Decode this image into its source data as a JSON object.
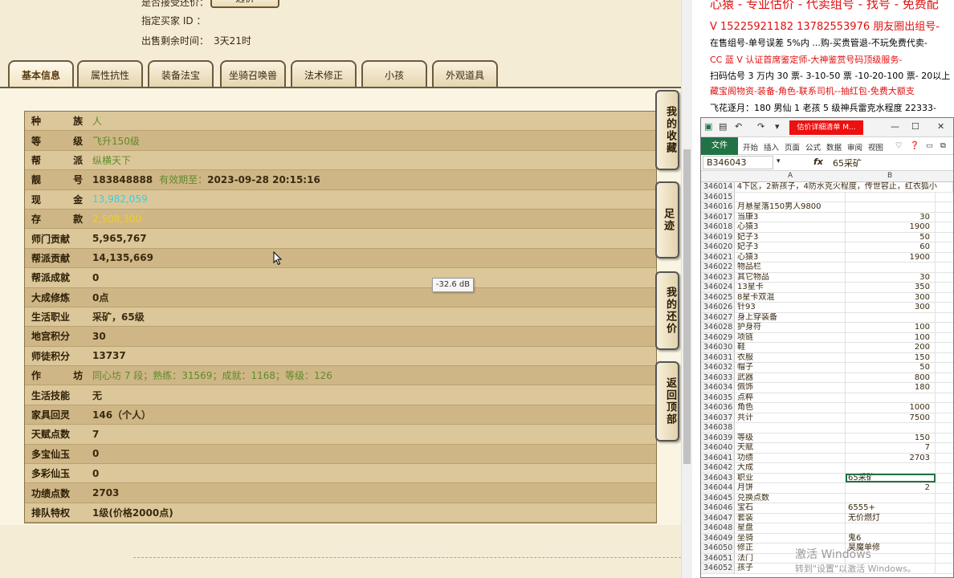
{
  "top": {
    "line0": "是否接受还价：",
    "choose_button": "选价",
    "buyer_label": "指定买家 ID ：",
    "time_label": "出售剩余时间：",
    "time_value": "3天21时"
  },
  "tabs": [
    "基本信息",
    "属性抗性",
    "装备法宝",
    "坐骑召唤兽",
    "法术修正",
    "小孩",
    "外观道具"
  ],
  "rows": [
    {
      "k": "种 族",
      "v": "人",
      "style": "green",
      "spaced": true
    },
    {
      "k": "等 级",
      "v": "飞升150级",
      "style": "green",
      "spaced": true
    },
    {
      "k": "帮 派",
      "v": "纵横天下",
      "style": "green",
      "spaced": true
    },
    {
      "k": "靓 号",
      "v": "183848888",
      "style": "bold",
      "spaced": true,
      "sub_label": "有效期至：",
      "sub_value": "2023-09-28 20:15:16"
    },
    {
      "k": "现 金",
      "v": "13,982,059",
      "style": "cyan",
      "spaced": true
    },
    {
      "k": "存 款",
      "v": "2,508,300",
      "style": "gold",
      "spaced": true
    },
    {
      "k": "师门贡献",
      "v": "5,965,767",
      "style": "bold"
    },
    {
      "k": "帮派贡献",
      "v": "14,135,669",
      "style": "bold"
    },
    {
      "k": "帮派成就",
      "v": "0",
      "style": "bold"
    },
    {
      "k": "大成修炼",
      "v": "0点",
      "style": "bold"
    },
    {
      "k": "生活职业",
      "v": "采矿，65级",
      "style": "bold"
    },
    {
      "k": "地宫积分",
      "v": "30",
      "style": "bold"
    },
    {
      "k": "师徒积分",
      "v": "13737",
      "style": "bold"
    },
    {
      "k": "作 坊",
      "v": "同心坊 7 段；熟练：31569；成就：1168；等级：126",
      "style": "green",
      "spaced": true
    },
    {
      "k": "生活技能",
      "v": "无",
      "style": "bold"
    },
    {
      "k": "家具回灵",
      "v": "146（个人）",
      "style": "bold"
    },
    {
      "k": "天赋点数",
      "v": "7",
      "style": "bold"
    },
    {
      "k": "多宝仙玉",
      "v": "0",
      "style": "bold"
    },
    {
      "k": "多彩仙玉",
      "v": "0",
      "style": "bold"
    },
    {
      "k": "功绩点数",
      "v": "2703",
      "style": "bold"
    },
    {
      "k": "排队特权",
      "v": "1级(价格2000点)",
      "style": "bold"
    }
  ],
  "side_buttons": [
    "我的收藏",
    "足迹",
    "我的还价",
    "返回顶部"
  ],
  "tooltip": "-32.6 dB",
  "web": {
    "line1": "心猿 - 专业估价 - 代卖组号 - 找号 - 免费配",
    "line2": "V 15225921182   13782553976 朋友圈出组号-",
    "line3": "在售组号-单号误差 5%内 ...购-买贵管退-不玩免费代卖-",
    "line4": "CC 蓝 V 认证首席鉴定师-大神鉴赏号码顶级服务-",
    "line5": "扫码估号 3 万内 30 票- 3-10-50 票  -10-20-100 票- 20以上 1",
    "line6": "藏宝阁物资-装备-角色-联系司机--抽红包-免费大额支",
    "line7": "飞花逐月：180 男仙 1 老孩 5 级神兵雷克水程度 22333-"
  },
  "excel": {
    "title_red": "估价详细清单 M...",
    "ribbon_file": "文件",
    "ribbon_tabs": [
      "开始",
      "插入",
      "页面",
      "公式",
      "数据",
      "审阅",
      "视图"
    ],
    "namebox": "B346043",
    "fx": "fx",
    "formula": "65采矿",
    "col_a": "A",
    "col_b": "B",
    "rows": [
      {
        "n": "346014",
        "a": "4下区，2新孩子，4防水克火程度，传世容止，红衣狐小",
        "b": "",
        "wide": true
      },
      {
        "n": "346015",
        "a": "",
        "b": ""
      },
      {
        "n": "346016",
        "a": "月悬星落150男人9800",
        "b": ""
      },
      {
        "n": "346017",
        "a": "当康3",
        "b": "30"
      },
      {
        "n": "346018",
        "a": "心猿3",
        "b": "1900"
      },
      {
        "n": "346019",
        "a": "妃子3",
        "b": "50"
      },
      {
        "n": "346020",
        "a": "妃子3",
        "b": "60"
      },
      {
        "n": "346021",
        "a": "心猿3",
        "b": "1900"
      },
      {
        "n": "346022",
        "a": "物品栏",
        "b": ""
      },
      {
        "n": "346023",
        "a": "其它物品",
        "b": "30"
      },
      {
        "n": "346024",
        "a": "13星卡",
        "b": "350"
      },
      {
        "n": "346025",
        "a": "8星卡双混",
        "b": "300"
      },
      {
        "n": "346026",
        "a": "针93",
        "b": "300"
      },
      {
        "n": "346027",
        "a": "身上穿装备",
        "b": ""
      },
      {
        "n": "346028",
        "a": "护身符",
        "b": "100"
      },
      {
        "n": "346029",
        "a": "项链",
        "b": "100"
      },
      {
        "n": "346030",
        "a": "鞋",
        "b": "200"
      },
      {
        "n": "346031",
        "a": "衣服",
        "b": "150"
      },
      {
        "n": "346032",
        "a": "帽子",
        "b": "50"
      },
      {
        "n": "346033",
        "a": "武器",
        "b": "800"
      },
      {
        "n": "346034",
        "a": "佩饰",
        "b": "180"
      },
      {
        "n": "346035",
        "a": "点粹",
        "b": ""
      },
      {
        "n": "346036",
        "a": "角色",
        "b": "1000"
      },
      {
        "n": "346037",
        "a": "共计",
        "b": "7500"
      },
      {
        "n": "346038",
        "a": "",
        "b": ""
      },
      {
        "n": "346039",
        "a": "等级",
        "b": "150"
      },
      {
        "n": "346040",
        "a": "天赋",
        "b": "7"
      },
      {
        "n": "346041",
        "a": "功绩",
        "b": "2703"
      },
      {
        "n": "346042",
        "a": "大成",
        "b": ""
      },
      {
        "n": "346043",
        "a": "职业",
        "b": "65采矿",
        "left": true,
        "sel": true
      },
      {
        "n": "346044",
        "a": "月饼",
        "b": "2"
      },
      {
        "n": "346045",
        "a": "兑换点数",
        "b": ""
      },
      {
        "n": "346046",
        "a": "宝石",
        "b": "6555+",
        "left": true
      },
      {
        "n": "346047",
        "a": "套装",
        "b": "无价燃灯",
        "left": true
      },
      {
        "n": "346048",
        "a": "星盘",
        "b": ""
      },
      {
        "n": "346049",
        "a": "坐骑",
        "b": "鬼6",
        "left": true
      },
      {
        "n": "346050",
        "a": "修正",
        "b": "昊魔单修",
        "left": true
      },
      {
        "n": "346051",
        "a": "法门",
        "b": ""
      },
      {
        "n": "346052",
        "a": "孩子",
        "b": ""
      }
    ],
    "watermark": "激活 Windows",
    "watermark2": "转到\"设置\"以激活 Windows。"
  },
  "colors": {
    "accent_green": "#217346",
    "red": "#e01010",
    "cyan": "#36d0e0",
    "gold": "#f0d020"
  }
}
